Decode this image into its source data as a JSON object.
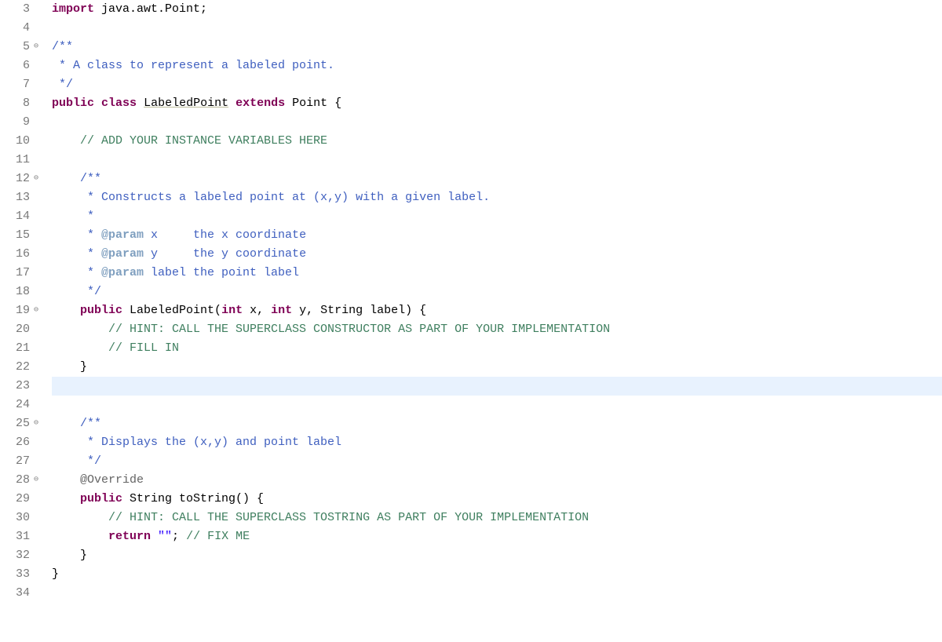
{
  "lines": [
    {
      "num": "3"
    },
    {
      "num": "4"
    },
    {
      "num": "5",
      "fold": true
    },
    {
      "num": "6"
    },
    {
      "num": "7"
    },
    {
      "num": "8"
    },
    {
      "num": "9"
    },
    {
      "num": "10"
    },
    {
      "num": "11"
    },
    {
      "num": "12",
      "fold": true
    },
    {
      "num": "13"
    },
    {
      "num": "14"
    },
    {
      "num": "15"
    },
    {
      "num": "16"
    },
    {
      "num": "17"
    },
    {
      "num": "18"
    },
    {
      "num": "19",
      "fold": true
    },
    {
      "num": "20"
    },
    {
      "num": "21"
    },
    {
      "num": "22"
    },
    {
      "num": "23"
    },
    {
      "num": "24"
    },
    {
      "num": "25",
      "fold": true
    },
    {
      "num": "26"
    },
    {
      "num": "27"
    },
    {
      "num": "28",
      "fold": true
    },
    {
      "num": "29"
    },
    {
      "num": "30"
    },
    {
      "num": "31"
    },
    {
      "num": "32"
    },
    {
      "num": "33"
    },
    {
      "num": "34"
    }
  ],
  "code": {
    "l3": {
      "kw": "import",
      "rest": " java.awt.Point;"
    },
    "l5": {
      "text": "/**"
    },
    "l6": {
      "text": " * A class to represent a labeled point."
    },
    "l7": {
      "text": " */"
    },
    "l8": {
      "kw1": "public",
      "kw2": "class",
      "type": "LabeledPoint",
      "kw3": "extends",
      "parent": "Point",
      "brace": " {"
    },
    "l10": {
      "text": "    // ADD YOUR INSTANCE VARIABLES HERE"
    },
    "l12": {
      "text": "    /**"
    },
    "l13": {
      "text": "     * Constructs a labeled point at (x,y) with a given label."
    },
    "l14": {
      "text": "     *"
    },
    "l15": {
      "pre": "     * ",
      "tag": "@param",
      "rest": " x     the x coordinate"
    },
    "l16": {
      "pre": "     * ",
      "tag": "@param",
      "rest": " y     the y coordinate"
    },
    "l17": {
      "pre": "     * ",
      "tag": "@param",
      "rest": " label the point label"
    },
    "l18": {
      "text": "     */"
    },
    "l19": {
      "indent": "    ",
      "kw1": "public",
      "name": " LabeledPoint(",
      "kw2": "int",
      "p1": " x, ",
      "kw3": "int",
      "p2": " y, String label) {"
    },
    "l20": {
      "text": "        // HINT: CALL THE SUPERCLASS CONSTRUCTOR AS PART OF YOUR IMPLEMENTATION"
    },
    "l21": {
      "text": "        // FILL IN"
    },
    "l22": {
      "text": "    }"
    },
    "l25": {
      "text": "    /**"
    },
    "l26": {
      "text": "     * Displays the (x,y) and point label"
    },
    "l27": {
      "text": "     */"
    },
    "l28": {
      "indent": "    ",
      "ann": "@Override"
    },
    "l29": {
      "indent": "    ",
      "kw1": "public",
      "rest": " String toString() {"
    },
    "l30": {
      "text": "        // HINT: CALL THE SUPERCLASS TOSTRING AS PART OF YOUR IMPLEMENTATION"
    },
    "l31": {
      "indent": "        ",
      "kw": "return",
      "str": " \"\"",
      "post": "; ",
      "comment": "// FIX ME"
    },
    "l32": {
      "text": "    }"
    },
    "l33": {
      "text": "}"
    }
  }
}
